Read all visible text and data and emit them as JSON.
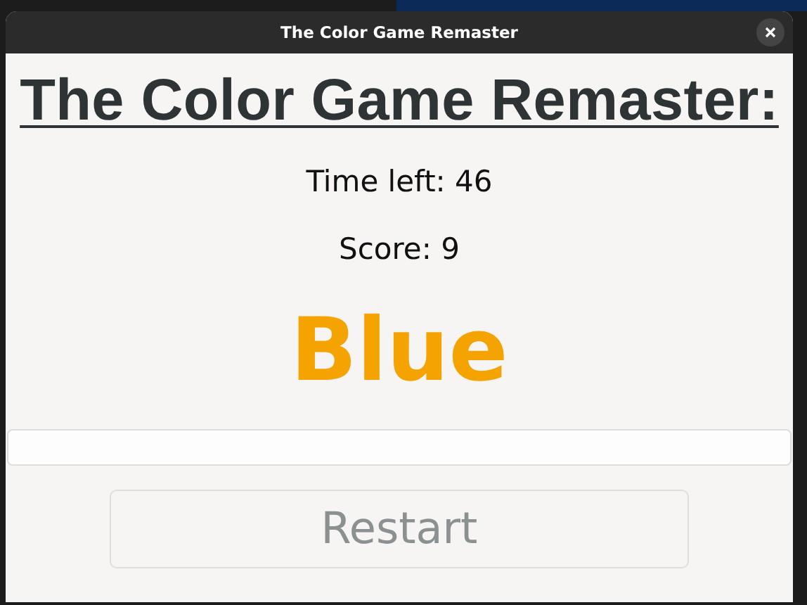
{
  "window": {
    "title": "The Color Game Remaster"
  },
  "heading": "The Color Game Remaster:",
  "time_left": "Time left: 46",
  "score": "Score: 9",
  "color_word": {
    "text": "Blue",
    "color": "#f5a300"
  },
  "restart_button": {
    "label": "Restart",
    "disabled": true
  }
}
